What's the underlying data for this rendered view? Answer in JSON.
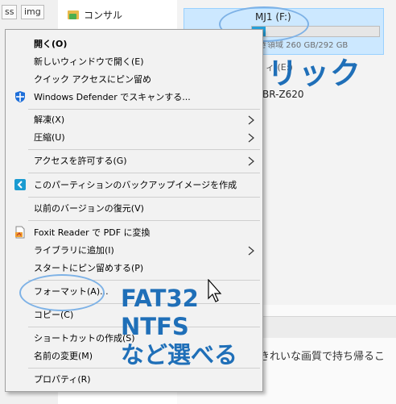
{
  "explorer": {
    "tabs": [
      "ss",
      "img"
    ],
    "folder": "コンサル",
    "drive": {
      "title": "MJ1 (F:)",
      "free_text": "空き領域 260 GB/292 GB",
      "used_fraction": 0.11
    },
    "second_tile_label": "ィ (E:)",
    "third_tile_label": "BR-Z620",
    "bottom_text": "きれいな画質で持ち帰るこ"
  },
  "menu": {
    "items": [
      {
        "label": "開く(O)",
        "bold": true
      },
      {
        "label": "新しいウィンドウで開く(E)"
      },
      {
        "label": "クイック アクセスにピン留め"
      },
      {
        "label": "Windows Defender でスキャンする...",
        "icon": "windows-defender-icon"
      },
      {
        "label": "解凍(X)",
        "submenu": true
      },
      {
        "label": "圧縮(U)",
        "submenu": true
      },
      {
        "label": "アクセスを許可する(G)",
        "submenu": true
      },
      {
        "label": "このパーティションのバックアップイメージを作成",
        "icon": "backup-tool-icon"
      },
      {
        "label": "以前のバージョンの復元(V)"
      },
      {
        "label": "Foxit Reader で PDF に変換",
        "icon": "foxit-pdf-icon"
      },
      {
        "label": "ライブラリに追加(I)",
        "submenu": true
      },
      {
        "label": "スタートにピン留めする(P)"
      },
      {
        "label": "フォーマット(A)..."
      },
      {
        "label": "コピー(C)"
      },
      {
        "label": "ショートカットの作成(S)"
      },
      {
        "label": "名前の変更(M)"
      },
      {
        "label": "プロパティ(R)"
      }
    ]
  },
  "annotations": {
    "right_click": "右クリック",
    "format_lines": [
      "FAT32",
      "NTFS",
      "など選べる"
    ]
  },
  "colors": {
    "accent_annotation": "#1f6fb8",
    "ellipse": "#7eb2e6",
    "selected_tile": "#cce8ff",
    "menu_bg": "#f2f2f2"
  }
}
